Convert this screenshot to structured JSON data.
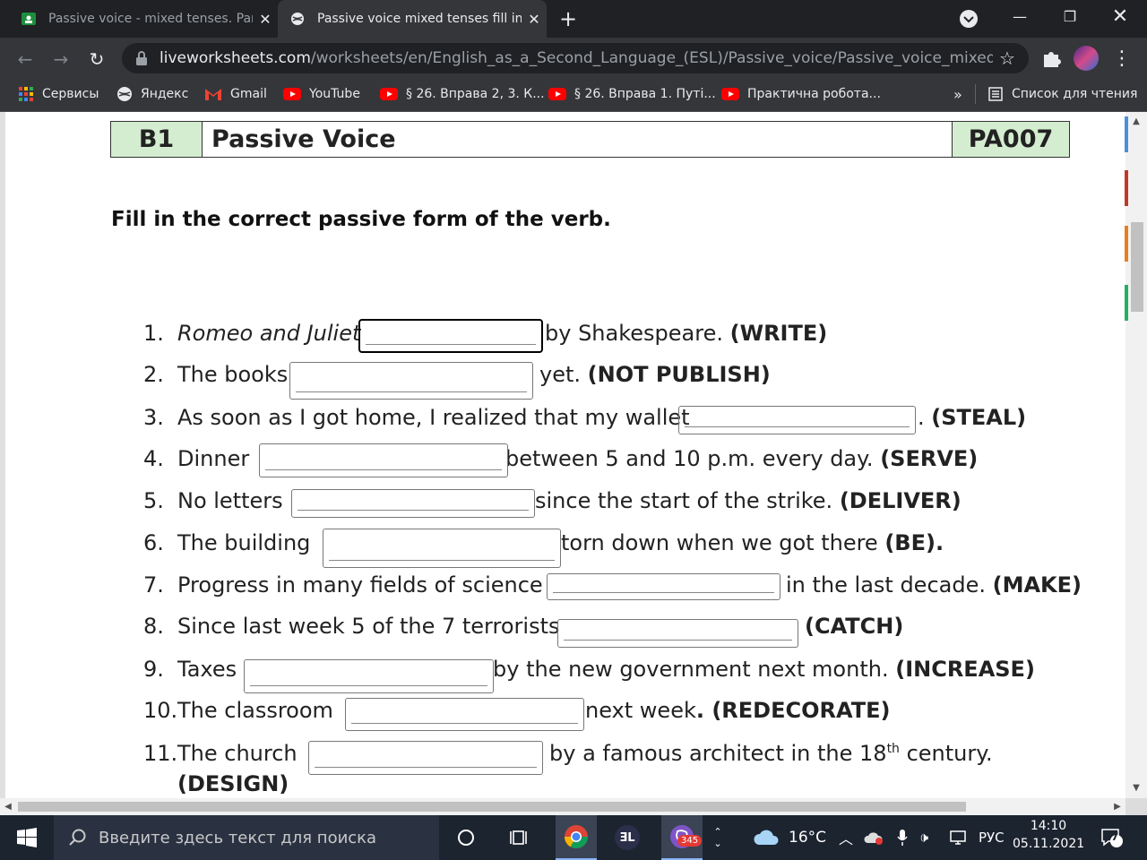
{
  "browser": {
    "tabs": [
      {
        "title": "Passive voice - mixed tenses. Part",
        "active": false,
        "favicon": "google-classroom-icon"
      },
      {
        "title": "Passive voice mixed tenses fill in t",
        "active": true,
        "favicon": "globe-icon"
      }
    ],
    "url_host": "liveworksheets.com",
    "url_path": "/worksheets/en/English_as_a_Second_Language_(ESL)/Passive_voice/Passive_voice_mixed_tenses_fi...",
    "bookmarks": [
      {
        "label": "Сервисы",
        "icon": "apps-grid-icon"
      },
      {
        "label": "Яндекс",
        "icon": "globe-icon"
      },
      {
        "label": "Gmail",
        "icon": "gmail-icon"
      },
      {
        "label": "YouTube",
        "icon": "youtube-icon"
      },
      {
        "label": "§ 26. Вправа 2, 3. К...",
        "icon": "youtube-icon"
      },
      {
        "label": "§ 26. Вправа 1. Путі...",
        "icon": "youtube-icon"
      },
      {
        "label": "Практична робота...",
        "icon": "youtube-icon"
      }
    ],
    "overflow": "»",
    "reading_list": "Список для чтения"
  },
  "worksheet": {
    "level": "B1",
    "title": "Passive Voice",
    "code": "PA007",
    "instruction": "Fill in the correct passive form of the verb.",
    "items": [
      {
        "num": "1.",
        "pre": "Romeo and Juliet",
        "post": "by Shakespeare.",
        "verb": "(WRITE)"
      },
      {
        "num": "2.",
        "pre": "The books",
        "post": "yet.",
        "verb": "(NOT PUBLISH)"
      },
      {
        "num": "3.",
        "pre": "As soon as I got home, I realized that my wallet",
        "post": ".",
        "verb": "(STEAL)"
      },
      {
        "num": "4.",
        "pre": "Dinner",
        "post": "between 5 and 10 p.m. every day.",
        "verb": "(SERVE)"
      },
      {
        "num": "5.",
        "pre": "No letters",
        "post": "since the start of the strike.",
        "verb": "(DELIVER)"
      },
      {
        "num": "6.",
        "pre": "The building",
        "post": "torn down when we got there",
        "verb": "(BE)."
      },
      {
        "num": "7.",
        "pre": "Progress in many fields of science",
        "post": "in the last decade.",
        "verb": "(MAKE)"
      },
      {
        "num": "8.",
        "pre": "Since last week 5 of the 7 terrorists",
        "post": "",
        "verb": "(CATCH)"
      },
      {
        "num": "9.",
        "pre": "Taxes",
        "post": "by the new government next month.",
        "verb": "(INCREASE)"
      },
      {
        "num": "10.",
        "pre": "The classroom",
        "post": "next week",
        "verb": ". (REDECORATE)"
      },
      {
        "num": "11.",
        "pre": "The church",
        "post": "by a famous architect in the 18",
        "sup": "th",
        "post2": "century.",
        "verb": "(DESIGN)"
      }
    ]
  },
  "taskbar": {
    "search_placeholder": "Введите здесь текст для поиска",
    "viber_badge": "345",
    "weather": "16°C",
    "language": "РУС",
    "time": "14:10",
    "date": "05.11.2021",
    "notifications": "7"
  }
}
